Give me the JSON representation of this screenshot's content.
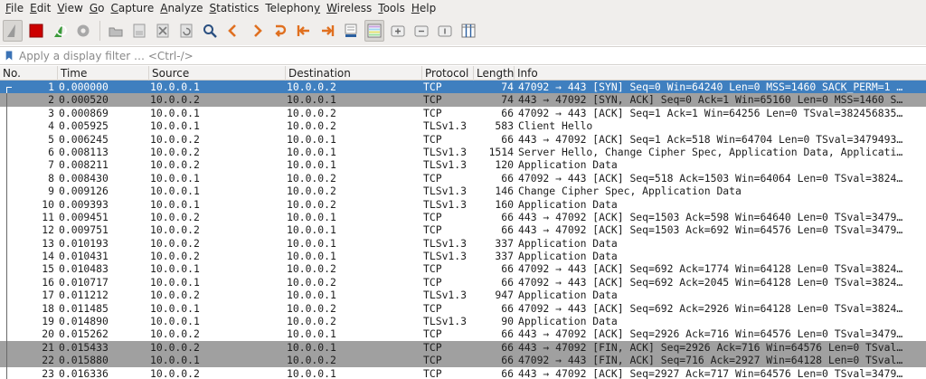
{
  "menu": [
    {
      "mnemonic": "F",
      "rest": "ile"
    },
    {
      "mnemonic": "E",
      "rest": "dit"
    },
    {
      "mnemonic": "V",
      "rest": "iew"
    },
    {
      "mnemonic": "G",
      "rest": "o"
    },
    {
      "mnemonic": "C",
      "rest": "apture"
    },
    {
      "mnemonic": "A",
      "rest": "nalyze"
    },
    {
      "mnemonic": "S",
      "rest": "tatistics"
    },
    {
      "mnemonic": "",
      "rest": "Telephon",
      "mnemonic_after": "y"
    },
    {
      "mnemonic": "W",
      "rest": "ireless"
    },
    {
      "mnemonic": "T",
      "rest": "ools"
    },
    {
      "mnemonic": "H",
      "rest": "elp"
    }
  ],
  "toolbar": {
    "icons": [
      "shark-fin-start-icon",
      "stop-capture-icon",
      "restart-capture-icon",
      "capture-options-icon",
      "open-file-icon",
      "save-file-icon",
      "close-file-icon",
      "reload-file-icon",
      "find-packet-icon",
      "go-back-icon",
      "go-forward-icon",
      "go-to-packet-icon",
      "go-first-icon",
      "go-last-icon",
      "autoscroll-icon",
      "colorize-icon",
      "zoom-in-icon",
      "zoom-out-icon",
      "normal-size-icon",
      "resize-columns-icon"
    ]
  },
  "filter": {
    "placeholder": "Apply a display filter … <Ctrl-/>",
    "value": ""
  },
  "columns": {
    "no": "No.",
    "time": "Time",
    "source": "Source",
    "destination": "Destination",
    "protocol": "Protocol",
    "length": "Length",
    "info": "Info"
  },
  "colors": {
    "selected_row": "#3f7fbf",
    "fin_row": "#a0a0a0",
    "stop_icon": "#cc0000",
    "restart_icon": "#3a9a3a"
  },
  "packets": [
    {
      "no": "1",
      "time": "0.000000",
      "src": "10.0.0.1",
      "dst": "10.0.0.2",
      "proto": "TCP",
      "len": "74",
      "info": "47092 → 443 [SYN] Seq=0 Win=64240 Len=0 MSS=1460 SACK_PERM=1 …",
      "style": "selected"
    },
    {
      "no": "2",
      "time": "0.000520",
      "src": "10.0.0.2",
      "dst": "10.0.0.1",
      "proto": "TCP",
      "len": "74",
      "info": "443 → 47092 [SYN, ACK] Seq=0 Ack=1 Win=65160 Len=0 MSS=1460 S…",
      "style": "grey"
    },
    {
      "no": "3",
      "time": "0.000869",
      "src": "10.0.0.1",
      "dst": "10.0.0.2",
      "proto": "TCP",
      "len": "66",
      "info": "47092 → 443 [ACK] Seq=1 Ack=1 Win=64256 Len=0 TSval=382456835…",
      "style": ""
    },
    {
      "no": "4",
      "time": "0.005925",
      "src": "10.0.0.1",
      "dst": "10.0.0.2",
      "proto": "TLSv1.3",
      "len": "583",
      "info": "Client Hello",
      "style": ""
    },
    {
      "no": "5",
      "time": "0.006245",
      "src": "10.0.0.2",
      "dst": "10.0.0.1",
      "proto": "TCP",
      "len": "66",
      "info": "443 → 47092 [ACK] Seq=1 Ack=518 Win=64704 Len=0 TSval=3479493…",
      "style": ""
    },
    {
      "no": "6",
      "time": "0.008113",
      "src": "10.0.0.2",
      "dst": "10.0.0.1",
      "proto": "TLSv1.3",
      "len": "1514",
      "info": "Server Hello, Change Cipher Spec, Application Data, Applicati…",
      "style": ""
    },
    {
      "no": "7",
      "time": "0.008211",
      "src": "10.0.0.2",
      "dst": "10.0.0.1",
      "proto": "TLSv1.3",
      "len": "120",
      "info": "Application Data",
      "style": ""
    },
    {
      "no": "8",
      "time": "0.008430",
      "src": "10.0.0.1",
      "dst": "10.0.0.2",
      "proto": "TCP",
      "len": "66",
      "info": "47092 → 443 [ACK] Seq=518 Ack=1503 Win=64064 Len=0 TSval=3824…",
      "style": ""
    },
    {
      "no": "9",
      "time": "0.009126",
      "src": "10.0.0.1",
      "dst": "10.0.0.2",
      "proto": "TLSv1.3",
      "len": "146",
      "info": "Change Cipher Spec, Application Data",
      "style": ""
    },
    {
      "no": "10",
      "time": "0.009393",
      "src": "10.0.0.1",
      "dst": "10.0.0.2",
      "proto": "TLSv1.3",
      "len": "160",
      "info": "Application Data",
      "style": ""
    },
    {
      "no": "11",
      "time": "0.009451",
      "src": "10.0.0.2",
      "dst": "10.0.0.1",
      "proto": "TCP",
      "len": "66",
      "info": "443 → 47092 [ACK] Seq=1503 Ack=598 Win=64640 Len=0 TSval=3479…",
      "style": ""
    },
    {
      "no": "12",
      "time": "0.009751",
      "src": "10.0.0.2",
      "dst": "10.0.0.1",
      "proto": "TCP",
      "len": "66",
      "info": "443 → 47092 [ACK] Seq=1503 Ack=692 Win=64576 Len=0 TSval=3479…",
      "style": ""
    },
    {
      "no": "13",
      "time": "0.010193",
      "src": "10.0.0.2",
      "dst": "10.0.0.1",
      "proto": "TLSv1.3",
      "len": "337",
      "info": "Application Data",
      "style": ""
    },
    {
      "no": "14",
      "time": "0.010431",
      "src": "10.0.0.2",
      "dst": "10.0.0.1",
      "proto": "TLSv1.3",
      "len": "337",
      "info": "Application Data",
      "style": ""
    },
    {
      "no": "15",
      "time": "0.010483",
      "src": "10.0.0.1",
      "dst": "10.0.0.2",
      "proto": "TCP",
      "len": "66",
      "info": "47092 → 443 [ACK] Seq=692 Ack=1774 Win=64128 Len=0 TSval=3824…",
      "style": ""
    },
    {
      "no": "16",
      "time": "0.010717",
      "src": "10.0.0.1",
      "dst": "10.0.0.2",
      "proto": "TCP",
      "len": "66",
      "info": "47092 → 443 [ACK] Seq=692 Ack=2045 Win=64128 Len=0 TSval=3824…",
      "style": ""
    },
    {
      "no": "17",
      "time": "0.011212",
      "src": "10.0.0.2",
      "dst": "10.0.0.1",
      "proto": "TLSv1.3",
      "len": "947",
      "info": "Application Data",
      "style": ""
    },
    {
      "no": "18",
      "time": "0.011485",
      "src": "10.0.0.1",
      "dst": "10.0.0.2",
      "proto": "TCP",
      "len": "66",
      "info": "47092 → 443 [ACK] Seq=692 Ack=2926 Win=64128 Len=0 TSval=3824…",
      "style": ""
    },
    {
      "no": "19",
      "time": "0.014890",
      "src": "10.0.0.1",
      "dst": "10.0.0.2",
      "proto": "TLSv1.3",
      "len": "90",
      "info": "Application Data",
      "style": ""
    },
    {
      "no": "20",
      "time": "0.015262",
      "src": "10.0.0.2",
      "dst": "10.0.0.1",
      "proto": "TCP",
      "len": "66",
      "info": "443 → 47092 [ACK] Seq=2926 Ack=716 Win=64576 Len=0 TSval=3479…",
      "style": ""
    },
    {
      "no": "21",
      "time": "0.015433",
      "src": "10.0.0.2",
      "dst": "10.0.0.1",
      "proto": "TCP",
      "len": "66",
      "info": "443 → 47092 [FIN, ACK] Seq=2926 Ack=716 Win=64576 Len=0 TSval…",
      "style": "grey"
    },
    {
      "no": "22",
      "time": "0.015880",
      "src": "10.0.0.1",
      "dst": "10.0.0.2",
      "proto": "TCP",
      "len": "66",
      "info": "47092 → 443 [FIN, ACK] Seq=716 Ack=2927 Win=64128 Len=0 TSval…",
      "style": "grey"
    },
    {
      "no": "23",
      "time": "0.016336",
      "src": "10.0.0.2",
      "dst": "10.0.0.1",
      "proto": "TCP",
      "len": "66",
      "info": "443 → 47092 [ACK] Seq=2927 Ack=717 Win=64576 Len=0 TSval=3479…",
      "style": ""
    }
  ]
}
